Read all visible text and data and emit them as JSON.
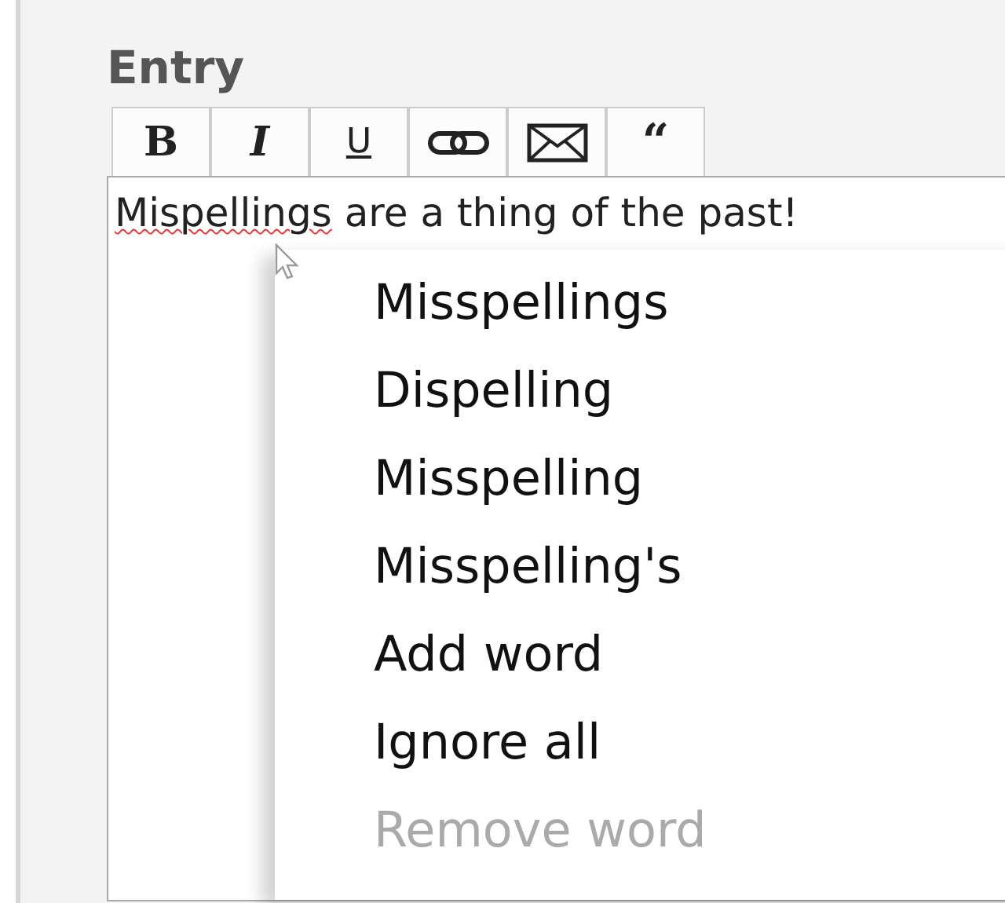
{
  "section_title": "Entry",
  "toolbar": [
    {
      "kind": "bold",
      "label": "B"
    },
    {
      "kind": "italic",
      "label": "I"
    },
    {
      "kind": "underline",
      "label": "U"
    },
    {
      "kind": "link"
    },
    {
      "kind": "mail"
    },
    {
      "kind": "quote",
      "label": "“"
    }
  ],
  "editor": {
    "misspelled_word": "Mispellings",
    "rest": " are a thing of the past!"
  },
  "context_menu": [
    {
      "label": "Misspellings",
      "disabled": false
    },
    {
      "label": "Dispelling",
      "disabled": false
    },
    {
      "label": "Misspelling",
      "disabled": false
    },
    {
      "label": "Misspelling's",
      "disabled": false
    },
    {
      "label": "Add word",
      "disabled": false
    },
    {
      "label": "Ignore all",
      "disabled": false
    },
    {
      "label": "Remove word",
      "disabled": true
    }
  ]
}
